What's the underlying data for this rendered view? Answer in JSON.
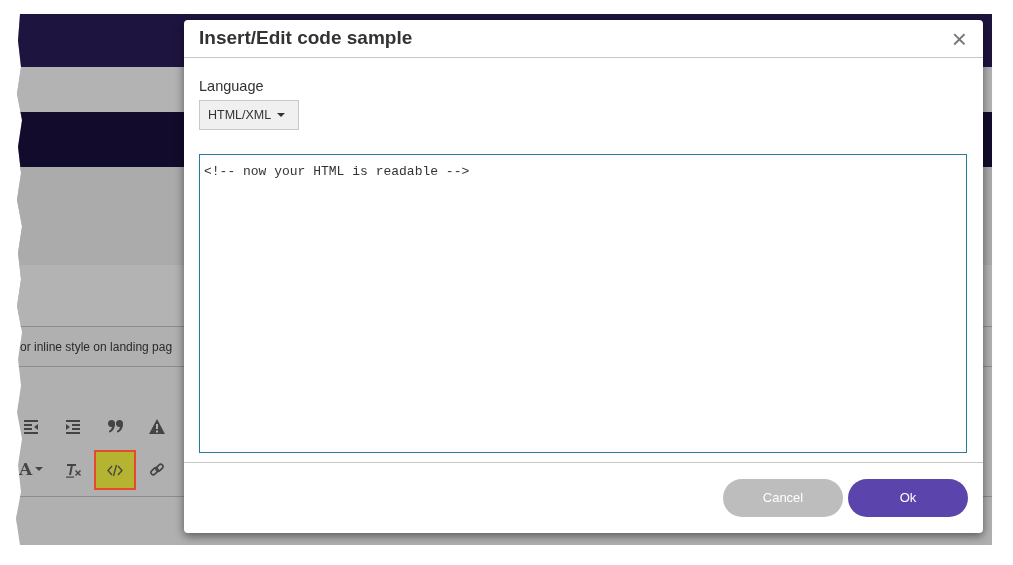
{
  "background": {
    "snippet_text": "or inline style on landing pag",
    "toolbar_rows": [
      [
        {
          "kind": "outdent",
          "highlighted": false
        },
        {
          "kind": "indent",
          "highlighted": false
        },
        {
          "kind": "quote",
          "highlighted": false
        },
        {
          "kind": "warning",
          "highlighted": false
        }
      ],
      [
        {
          "kind": "font-color",
          "label": "A",
          "highlighted": false
        },
        {
          "kind": "clear-format",
          "highlighted": false
        },
        {
          "kind": "code",
          "highlighted": true
        },
        {
          "kind": "link",
          "highlighted": false
        }
      ]
    ]
  },
  "dialog": {
    "title": "Insert/Edit code sample",
    "close": "×",
    "language_label": "Language",
    "language_value": "HTML/XML",
    "code": "<!-- now your HTML is readable -->",
    "buttons": [
      {
        "label": "Cancel",
        "kind": "secondary"
      },
      {
        "label": "Ok",
        "kind": "primary"
      }
    ]
  }
}
